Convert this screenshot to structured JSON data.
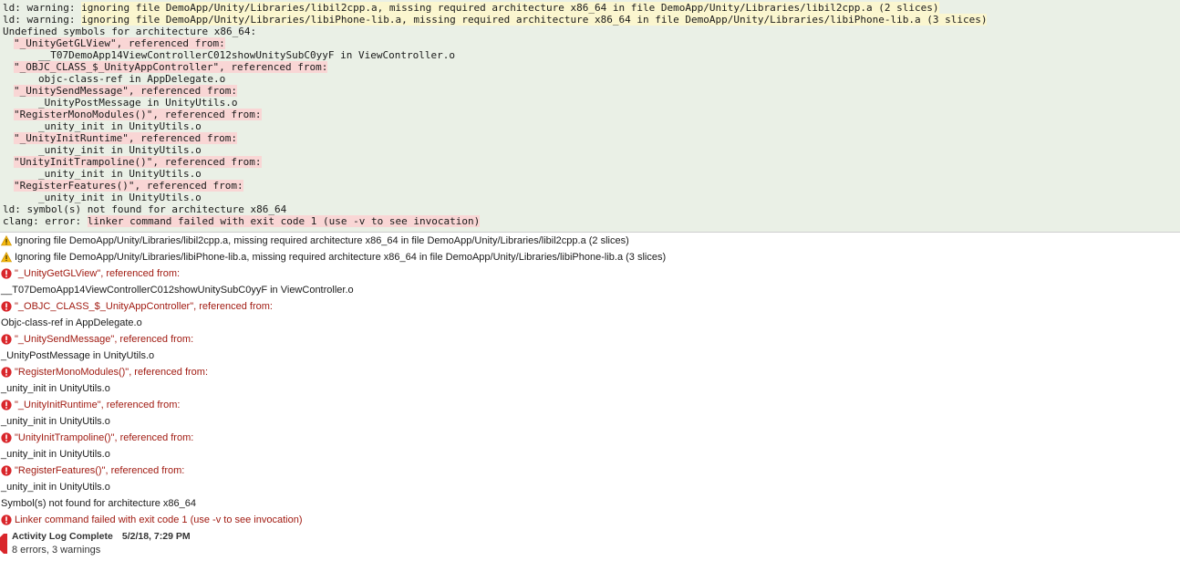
{
  "console": {
    "lines": [
      {
        "prefix": "ld: warning: ",
        "hl": "ignoring file DemoApp/Unity/Libraries/libil2cpp.a, missing required architecture x86_64 in file DemoApp/Unity/Libraries/libil2cpp.a (2 slices)"
      },
      {
        "prefix": "ld: warning: ",
        "hl": "ignoring file DemoApp/Unity/Libraries/libiPhone-lib.a, missing required architecture x86_64 in file DemoApp/Unity/Libraries/libiPhone-lib.a (3 slices)"
      },
      {
        "text": "Undefined symbols for architecture x86_64:"
      },
      {
        "sym": "\"_UnityGetGLView\", referenced from:"
      },
      {
        "ref": "__T07DemoApp14ViewControllerC012showUnitySubC0yyF in ViewController.o"
      },
      {
        "sym": "\"_OBJC_CLASS_$_UnityAppController\", referenced from:"
      },
      {
        "ref": "objc-class-ref in AppDelegate.o"
      },
      {
        "sym": "\"_UnitySendMessage\", referenced from:"
      },
      {
        "ref": "_UnityPostMessage in UnityUtils.o"
      },
      {
        "sym": "\"RegisterMonoModules()\", referenced from:"
      },
      {
        "ref": "_unity_init in UnityUtils.o"
      },
      {
        "sym": "\"_UnityInitRuntime\", referenced from:"
      },
      {
        "ref": "_unity_init in UnityUtils.o"
      },
      {
        "sym": "\"UnityInitTrampoline()\", referenced from:"
      },
      {
        "ref": "_unity_init in UnityUtils.o"
      },
      {
        "sym": "\"RegisterFeatures()\", referenced from:"
      },
      {
        "ref": "_unity_init in UnityUtils.o"
      },
      {
        "text": "ld: symbol(s) not found for architecture x86_64"
      },
      {
        "prefix": "clang: error: ",
        "err": "linker command failed with exit code 1 (use -v to see invocation)"
      }
    ]
  },
  "issues": [
    {
      "kind": "warning",
      "text": "Ignoring file DemoApp/Unity/Libraries/libil2cpp.a, missing required architecture x86_64 in file DemoApp/Unity/Libraries/libil2cpp.a (2 slices)",
      "icon": "warning-triangle-icon"
    },
    {
      "kind": "warning",
      "text": "Ignoring file DemoApp/Unity/Libraries/libiPhone-lib.a, missing required architecture x86_64 in file DemoApp/Unity/Libraries/libiPhone-lib.a (3 slices)",
      "icon": "warning-triangle-icon"
    },
    {
      "kind": "error",
      "text": "\"_UnityGetGLView\", referenced from:",
      "icon": "error-circle-icon"
    },
    {
      "kind": "detail",
      "text": "__T07DemoApp14ViewControllerC012showUnitySubC0yyF in ViewController.o"
    },
    {
      "kind": "error",
      "text": "\"_OBJC_CLASS_$_UnityAppController\", referenced from:",
      "icon": "error-circle-icon"
    },
    {
      "kind": "detail",
      "text": "Objc-class-ref in AppDelegate.o"
    },
    {
      "kind": "error",
      "text": "\"_UnitySendMessage\", referenced from:",
      "icon": "error-circle-icon"
    },
    {
      "kind": "detail",
      "text": "_UnityPostMessage in UnityUtils.o"
    },
    {
      "kind": "error",
      "text": "\"RegisterMonoModules()\", referenced from:",
      "icon": "error-circle-icon"
    },
    {
      "kind": "detail",
      "text": "_unity_init in UnityUtils.o"
    },
    {
      "kind": "error",
      "text": "\"_UnityInitRuntime\", referenced from:",
      "icon": "error-circle-icon"
    },
    {
      "kind": "detail",
      "text": "_unity_init in UnityUtils.o"
    },
    {
      "kind": "error",
      "text": "\"UnityInitTrampoline()\", referenced from:",
      "icon": "error-circle-icon"
    },
    {
      "kind": "detail",
      "text": "_unity_init in UnityUtils.o"
    },
    {
      "kind": "error",
      "text": "\"RegisterFeatures()\", referenced from:",
      "icon": "error-circle-icon"
    },
    {
      "kind": "detail",
      "text": "_unity_init in UnityUtils.o"
    },
    {
      "kind": "detail",
      "text": "Symbol(s) not found for architecture x86_64"
    },
    {
      "kind": "error",
      "text": "Linker command failed with exit code 1 (use -v to see invocation)",
      "icon": "error-circle-icon"
    }
  ],
  "summary": {
    "title": "Activity Log Complete",
    "date": "5/2/18, 7:29 PM",
    "counts": "8 errors, 3 warnings",
    "icon": "stop-octagon-icon"
  },
  "colors": {
    "console_bg": "#eaf0e6",
    "warn_highlight": "#fbf6cf",
    "error_highlight": "#f9d6d5",
    "error_text": "#a11b12",
    "error_icon": "#d9262b",
    "warning_icon": "#f5b90f"
  }
}
